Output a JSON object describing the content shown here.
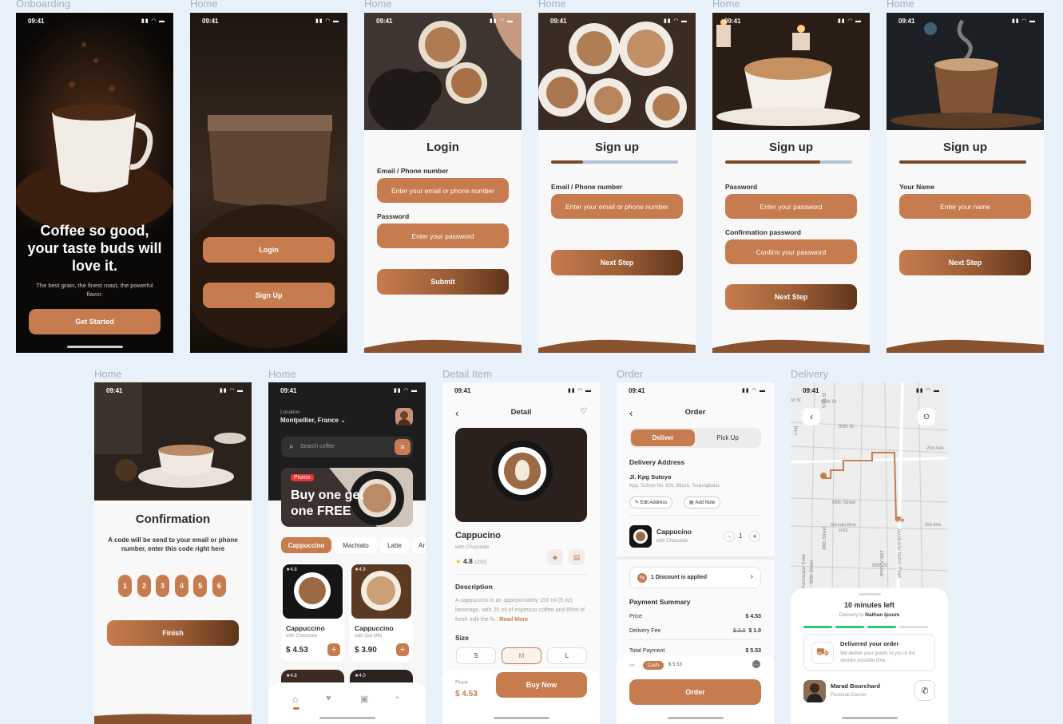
{
  "status_time": "09:41",
  "frame_labels": [
    "Onboarding",
    "Home",
    "Home",
    "Home",
    "Home",
    "Home",
    "Home",
    "Home",
    "Detail Item",
    "Order",
    "Delivery"
  ],
  "onboarding": {
    "headline": "Coffee so good, your taste buds will love it.",
    "sub": "The best grain, the finest roast, the powerful flavor.",
    "cta": "Get Started"
  },
  "welcome": {
    "login": "Login",
    "signup": "Sign Up"
  },
  "login": {
    "title": "Login",
    "email_label": "Email / Phone number",
    "email_placeholder": "Enter your email or phone number",
    "password_label": "Password",
    "password_placeholder": "Enter your password",
    "submit": "Submit"
  },
  "signup1": {
    "title": "Sign up",
    "progress": 0.25,
    "email_label": "Email / Phone number",
    "email_placeholder": "Enter your email or phone number",
    "next": "Next Step"
  },
  "signup2": {
    "title": "Sign up",
    "progress": 0.75,
    "password_label": "Password",
    "password_placeholder": "Enter your password",
    "confirm_label": "Confirmation password",
    "confirm_placeholder": "Confirm your password",
    "next": "Next Step"
  },
  "signup3": {
    "title": "Sign up",
    "progress": 1.0,
    "name_label": "Your Name",
    "name_placeholder": "Enter your name",
    "next": "Next Step"
  },
  "confirmation": {
    "title": "Confirmation",
    "desc": "A code will be send to your email or phone number, enter this code right here",
    "digits": [
      "1",
      "2",
      "3",
      "4",
      "5",
      "6"
    ],
    "finish": "Finish"
  },
  "home": {
    "location_label": "Location",
    "location": "Montpellier, France",
    "search_placeholder": "Search coffee",
    "promo_badge": "Promo",
    "promo_line1": "Buy one get",
    "promo_line2": "one FREE",
    "categories": [
      "Cappuccino",
      "Machiato",
      "Latte",
      "Ar"
    ],
    "products": [
      {
        "rating": "4.8",
        "name": "Cappuccino",
        "sub": "with Chocolate",
        "price": "$ 4.53"
      },
      {
        "rating": "4.9",
        "name": "Cappuccino",
        "sub": "with Oat Milk",
        "price": "$ 3.90"
      }
    ],
    "more_ratings": [
      "4.8",
      "4.0"
    ]
  },
  "detail": {
    "title": "Detail",
    "name": "Cappucino",
    "sub": "with Chocolate",
    "rating": "4.8",
    "rating_count": "(230)",
    "desc_title": "Description",
    "desc": "A cappuccino is an approximately 150 ml (5 oz) beverage, with 25 ml of espresso coffee and 85ml of fresh milk the fo..",
    "read_more": "Read More",
    "size_title": "Size",
    "sizes": [
      "S",
      "M",
      "L"
    ],
    "price_label": "Price",
    "price": "$ 4.53",
    "buy": "Buy Now"
  },
  "order": {
    "title": "Order",
    "tabs": [
      "Deliver",
      "Pick Up"
    ],
    "addr_title": "Delivery Address",
    "addr_name": "Jl. Kpg Sutoyo",
    "addr_detail": "Kpg. Sutoyo No. 620, Bilzen, Tanjungbalai.",
    "edit": "Edit Address",
    "note": "Add Note",
    "item_name": "Cappucino",
    "item_sub": "with Chocolate",
    "qty": "1",
    "discount": "1 Discount is applied",
    "summary_title": "Payment Summary",
    "price_label": "Price",
    "price": "$ 4.53",
    "fee_label": "Delivery Fee",
    "fee_old": "$ 2.0",
    "fee": "$ 1.0",
    "total_label": "Total Payment",
    "total": "$ 5.53",
    "cash": "Cash",
    "cash_amount": "$ 5.53",
    "order_btn": "Order"
  },
  "delivery": {
    "streets": [
      "95th St",
      "95th St",
      "2nd Ave",
      "86th Street",
      "3rd Ave",
      "86th St",
      "97th St",
      "Nirmala Birla HSS",
      "88th Street",
      "19th Avenue",
      "Jawaharlal Nehru Road",
      "Kamarajar Salai",
      "89th Street",
      "rd St",
      "Ling"
    ],
    "eta": "10 minutes left",
    "delivery_to_prefix": "Delivery to ",
    "delivery_to_name": "Nathan Ipsum",
    "status_title": "Delivered your order",
    "status_desc": "We deliver your goods to you in the shortes possible time.",
    "courier_name": "Marad Bourchard",
    "courier_role": "Personal Courier"
  },
  "colors": {
    "accent": "#c67c4e",
    "dark_brown": "#5e3519",
    "bg": "#e9f1fb"
  }
}
